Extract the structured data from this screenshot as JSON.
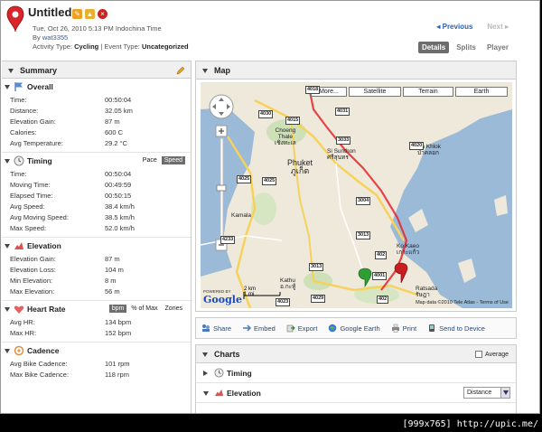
{
  "header": {
    "title": "Untitled",
    "date": "Tue, Oct 26, 2010 5:13 PM Indochina Time",
    "by_label": "By",
    "user": "wat3355",
    "activity_type_label": "Activity Type:",
    "activity_type": "Cycling",
    "separator": "|",
    "event_type_label": "Event Type:",
    "event_type": "Uncategorized"
  },
  "pager": {
    "previous": "Previous",
    "next": "Next"
  },
  "tabs": [
    "Details",
    "Splits",
    "Player"
  ],
  "summary": {
    "title": "Summary",
    "overall": {
      "title": "Overall",
      "rows": [
        {
          "k": "Time:",
          "v": "00:50:04"
        },
        {
          "k": "Distance:",
          "v": "32.05 km"
        },
        {
          "k": "Elevation Gain:",
          "v": "87 m"
        },
        {
          "k": "Calories:",
          "v": "600 C"
        },
        {
          "k": "Avg Temperature:",
          "v": "29.2 °C"
        }
      ]
    },
    "timing": {
      "title": "Timing",
      "toggle": [
        "Pace",
        "Speed"
      ],
      "rows": [
        {
          "k": "Time:",
          "v": "00:50:04"
        },
        {
          "k": "Moving Time:",
          "v": "00:49:59"
        },
        {
          "k": "Elapsed Time:",
          "v": "00:50:15"
        },
        {
          "k": "Avg Speed:",
          "v": "38.4 km/h"
        },
        {
          "k": "Avg Moving Speed:",
          "v": "38.5 km/h"
        },
        {
          "k": "Max Speed:",
          "v": "52.0 km/h"
        }
      ]
    },
    "elevation": {
      "title": "Elevation",
      "rows": [
        {
          "k": "Elevation Gain:",
          "v": "87 m"
        },
        {
          "k": "Elevation Loss:",
          "v": "104 m"
        },
        {
          "k": "Min Elevation:",
          "v": "8 m"
        },
        {
          "k": "Max Elevation:",
          "v": "56 m"
        }
      ]
    },
    "heart_rate": {
      "title": "Heart Rate",
      "toggle": [
        "bpm",
        "% of Max",
        "Zones"
      ],
      "rows": [
        {
          "k": "Avg HR:",
          "v": "134 bpm"
        },
        {
          "k": "Max HR:",
          "v": "152 bpm"
        }
      ]
    },
    "cadence": {
      "title": "Cadence",
      "rows": [
        {
          "k": "Avg Bike Cadence:",
          "v": "101 rpm"
        },
        {
          "k": "Max Bike Cadence:",
          "v": "118 rpm"
        }
      ]
    }
  },
  "map": {
    "title": "Map",
    "types": [
      "More...",
      "Satellite",
      "Terrain",
      "Earth"
    ],
    "labels": {
      "choeng": "Choeng",
      "thale": "Thale",
      "choeng_th": "เชิงทะเล",
      "phuket": "Phuket",
      "phuket_th": "ภูเก็ต",
      "si_sunthon": "Si Sunthon",
      "si_sunthon_th": "ศรีสุนทร",
      "pa_khlok": "Pa Khlok",
      "pa_khlok_th": "ป่าคลอก",
      "kamala": "Kamala",
      "ko_kaeo": "Ko Kaeo",
      "ko_kaeo_th": "เกาะแก้ว",
      "kathu": "Kathu",
      "kathu_th": "อ.กะทู้",
      "ratsada": "Ratsada",
      "ratsada_th": "รัษฎา"
    },
    "roads": [
      "4018",
      "4030",
      "4015",
      "4031",
      "4025",
      "3033",
      "3004",
      "4025",
      "3013",
      "402",
      "3013",
      "4233",
      "4029",
      "4023",
      "402",
      "4001",
      "4020"
    ],
    "scale_km": "2 km",
    "scale_mi": "1 mi",
    "powered": "POWERED BY",
    "google": "Google",
    "terms": "Map data ©2010 Tele Atlas - Terms of Use"
  },
  "actions": [
    "Share",
    "Embed",
    "Export",
    "Google Earth",
    "Print",
    "Send to Device"
  ],
  "charts": {
    "title": "Charts",
    "average": "Average",
    "items": [
      "Timing",
      "Elevation"
    ],
    "select_value": "Distance"
  },
  "watermark": "[999x765] http://upic.me/"
}
